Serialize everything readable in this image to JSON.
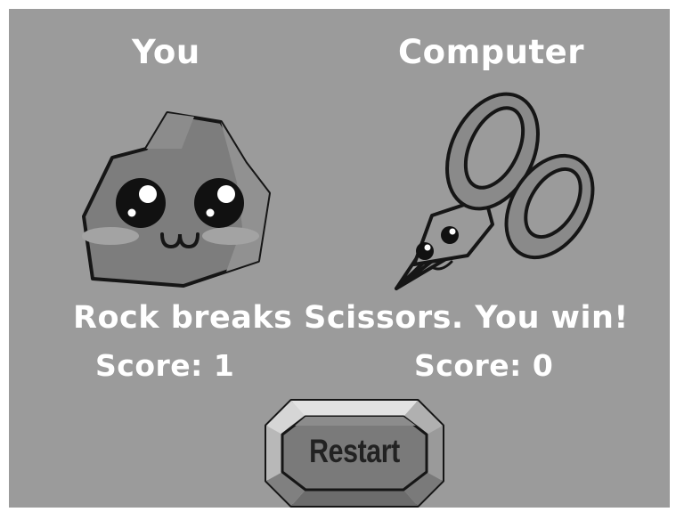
{
  "players": {
    "you": {
      "label": "You",
      "choice_icon": "rock-icon",
      "score_text": "Score: 1"
    },
    "computer": {
      "label": "Computer",
      "choice_icon": "scissors-icon",
      "score_text": "Score: 0"
    }
  },
  "result_text": "Rock breaks Scissors. You win!",
  "restart_label": "Restart",
  "colors": {
    "background": "#9b9b9b",
    "text": "#ffffff",
    "rock_fill": "#7d7d7d",
    "button_face": "#7a7a7a"
  }
}
